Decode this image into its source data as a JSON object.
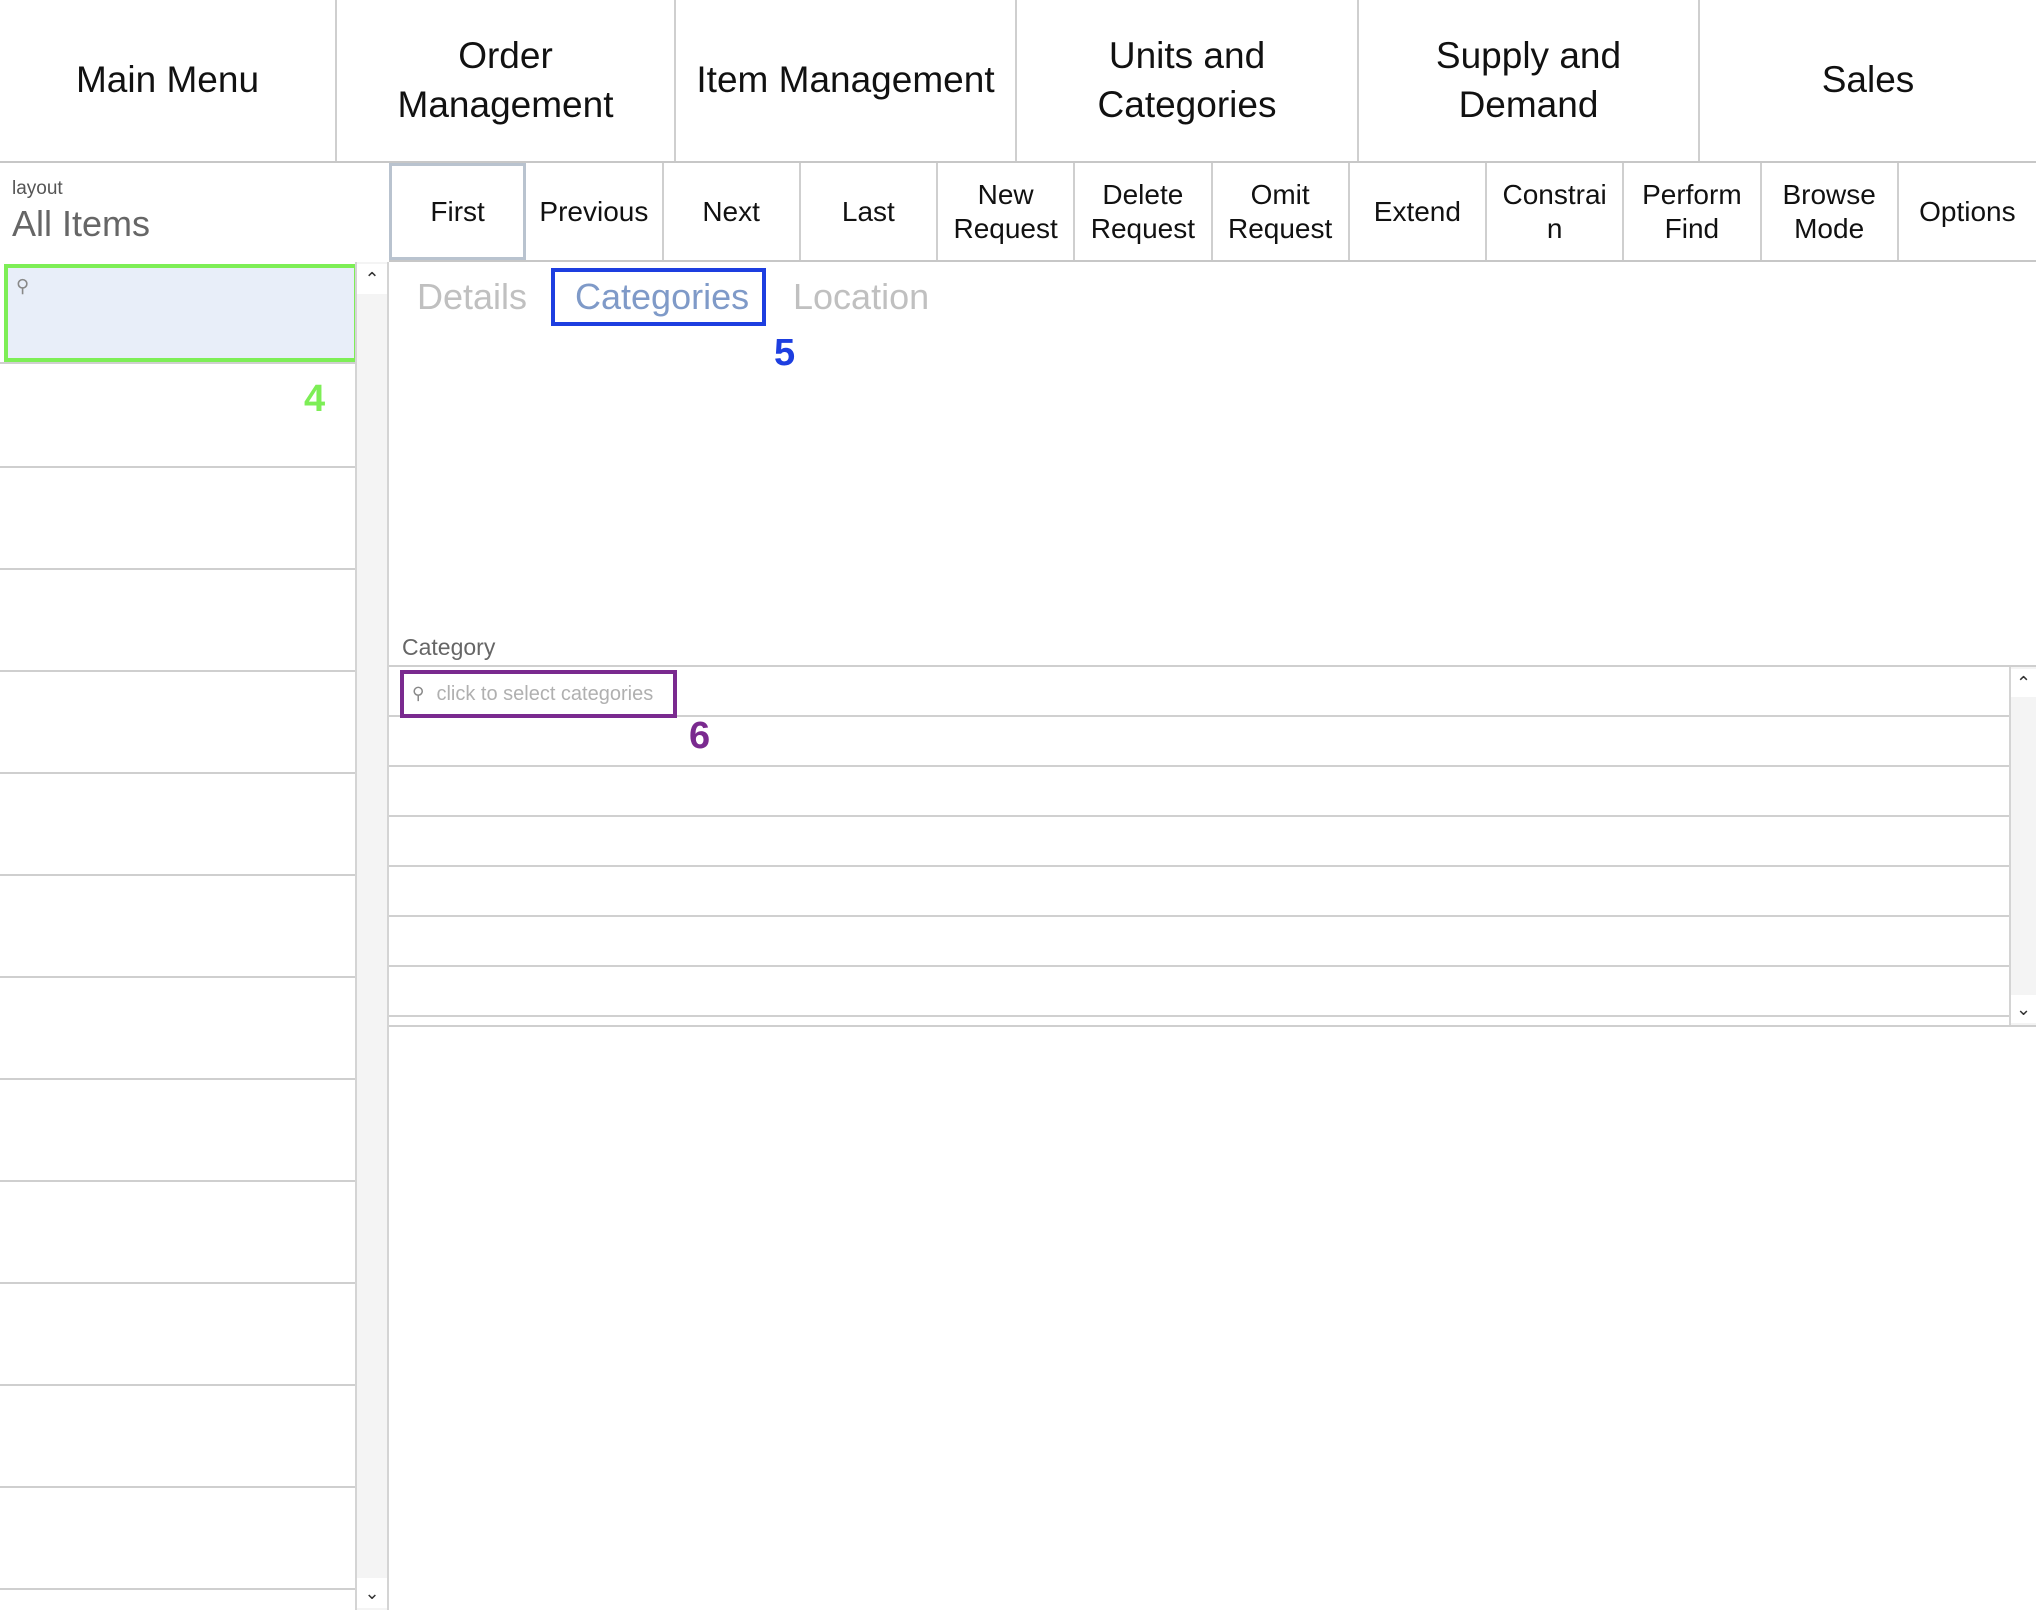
{
  "nav": {
    "items": [
      {
        "label": "Main Menu"
      },
      {
        "label": "Order Management"
      },
      {
        "label": "Item Management"
      },
      {
        "label": "Units and\nCategories"
      },
      {
        "label": "Supply and Demand"
      },
      {
        "label": "Sales"
      }
    ]
  },
  "layout": {
    "label": "layout",
    "value": "All Items"
  },
  "toolbar": {
    "buttons": [
      {
        "label": "First"
      },
      {
        "label": "Previous"
      },
      {
        "label": "Next"
      },
      {
        "label": "Last"
      },
      {
        "label": "New\nRequest"
      },
      {
        "label": "Delete\nRequest"
      },
      {
        "label": "Omit\nRequest"
      },
      {
        "label": "Extend"
      },
      {
        "label": "Constrai\nn"
      },
      {
        "label": "Perform\nFind"
      },
      {
        "label": "Browse\nMode"
      },
      {
        "label": "Options"
      }
    ]
  },
  "tabs": {
    "details": "Details",
    "categories": "Categories",
    "location": "Location",
    "active": "Categories"
  },
  "category": {
    "label": "Category",
    "search_placeholder": "click to select categories"
  },
  "markers": {
    "list_search": "4",
    "categories_tab": "5",
    "category_search": "6"
  },
  "colors": {
    "marker_green": "#7dee56",
    "marker_blue": "#1d3ee0",
    "marker_purple": "#7a2a8f"
  },
  "icons": {
    "search": "search-icon",
    "scroll_up": "chevron-up-icon",
    "scroll_down": "chevron-down-icon"
  }
}
